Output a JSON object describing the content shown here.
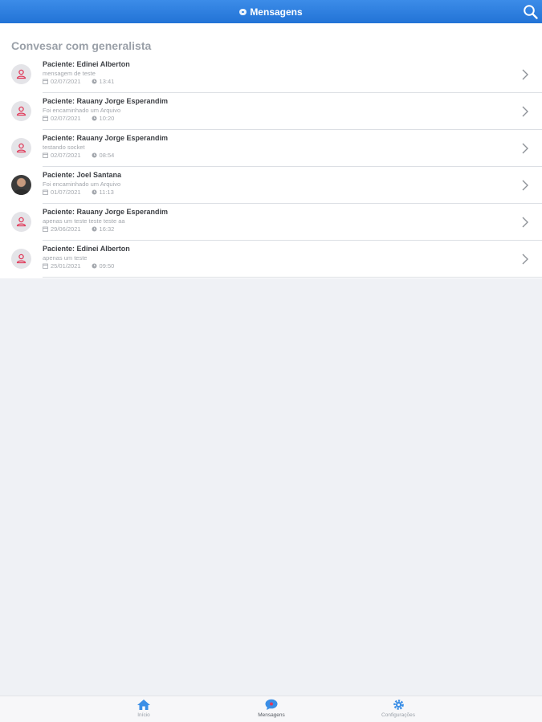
{
  "header": {
    "title": "Mensagens",
    "title_icon": "chat-icon",
    "search_icon": "search-icon"
  },
  "section": {
    "title": "Convesar com generalista"
  },
  "conversations": [
    {
      "name": "Paciente: Edinei Alberton",
      "message": "mensagem de teste",
      "date": "02/07/2021",
      "time": "13:41",
      "avatar": "person-placeholder-icon"
    },
    {
      "name": "Paciente: Rauany Jorge Esperandim",
      "message": "Foi encaminhado um Arquivo",
      "date": "02/07/2021",
      "time": "10:20",
      "avatar": "person-placeholder-icon"
    },
    {
      "name": "Paciente: Rauany Jorge Esperandim",
      "message": "testando socket",
      "date": "02/07/2021",
      "time": "08:54",
      "avatar": "person-placeholder-icon"
    },
    {
      "name": "Paciente: Joel Santana",
      "message": "Foi encaminhado um Arquivo",
      "date": "01/07/2021",
      "time": "11:13",
      "avatar": "user-photo"
    },
    {
      "name": "Paciente: Rauany Jorge Esperandim",
      "message": "apenas um teste teste teste aa",
      "date": "29/06/2021",
      "time": "16:32",
      "avatar": "person-placeholder-icon"
    },
    {
      "name": "Paciente: Edinei Alberton",
      "message": "apenas um teste",
      "date": "25/01/2021",
      "time": "09:50",
      "avatar": "person-placeholder-icon"
    }
  ],
  "tabbar": {
    "tabs": [
      {
        "label": "Início",
        "icon": "home-icon",
        "active": false
      },
      {
        "label": "Mensagens",
        "icon": "chat-bubble-icon",
        "active": true
      },
      {
        "label": "Configurações",
        "icon": "gear-icon",
        "active": false
      }
    ]
  },
  "colors": {
    "header_gradient_top": "#3c8ce8",
    "header_gradient_bottom": "#2273d6",
    "avatar_icon": "#e03a5a",
    "tab_icon": "#3a8ee6"
  }
}
